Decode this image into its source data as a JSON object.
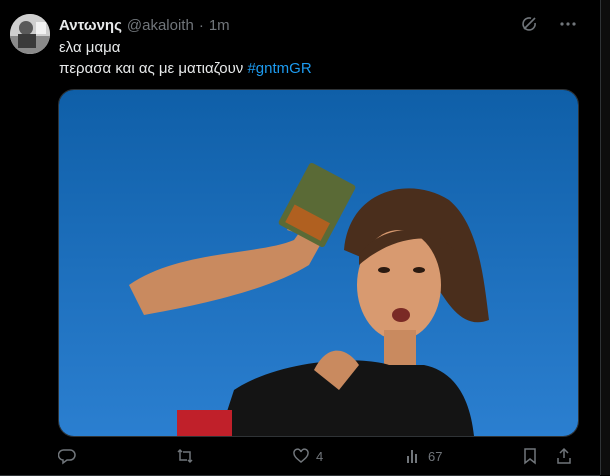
{
  "tweet": {
    "author_name": "Αντωνης",
    "author_handle": "@akaloith",
    "separator": "·",
    "time": "1m",
    "line1": "ελα μαμα",
    "line2_text": "περασα και ας με ματιαζουν ",
    "hashtag": "#gntmGR",
    "likes": "4",
    "views": "67"
  },
  "icons": {
    "header": [
      "grok-icon",
      "more-icon"
    ],
    "actions": [
      "reply-icon",
      "retweet-icon",
      "like-icon",
      "views-icon",
      "bookmark-icon",
      "share-icon"
    ]
  },
  "colors": {
    "accent": "#1d9bf0",
    "muted": "#71767b",
    "text": "#e7e9ea",
    "background": "#000000"
  }
}
